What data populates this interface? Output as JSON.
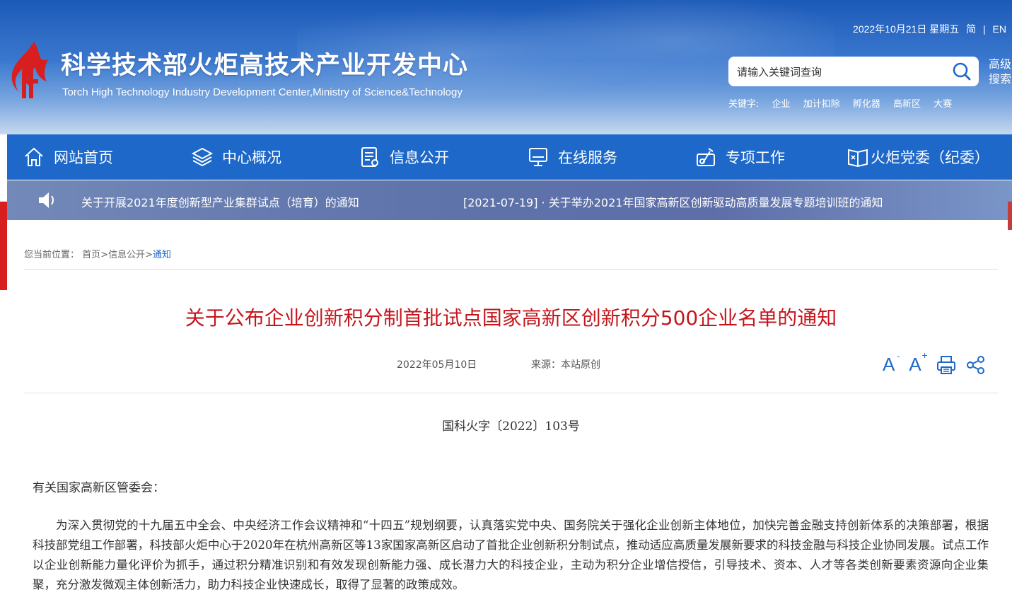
{
  "header": {
    "site_title_cn": "科学技术部火炬高技术产业开发中心",
    "site_title_en": "Torch High Technology Industry Development Center,Ministry of Science&Technology",
    "date": "2022年10月21日 星期五",
    "lang_simplified": "简",
    "separator": "|",
    "lang_english": "EN",
    "search_placeholder": "请输入关键词查询",
    "advanced_search": "高级搜索",
    "keywords_label": "关键字:",
    "keywords": [
      "企业",
      "加计扣除",
      "孵化器",
      "高新区",
      "大赛"
    ]
  },
  "nav": [
    {
      "label": "网站首页",
      "icon": "home-icon"
    },
    {
      "label": "中心概况",
      "icon": "layers-icon"
    },
    {
      "label": "信息公开",
      "icon": "document-icon"
    },
    {
      "label": "在线服务",
      "icon": "monitor-icon"
    },
    {
      "label": "专项工作",
      "icon": "tools-icon"
    },
    {
      "label": "火炬党委（纪委）",
      "icon": "party-book-icon"
    }
  ],
  "notice": {
    "items": [
      "关于开展2021年度创新型产业集群试点（培育）的通知",
      "[2021-07-19] · 关于举办2021年国家高新区创新驱动高质量发展专题培训班的通知"
    ]
  },
  "breadcrumb": {
    "label": "您当前位置：",
    "home": "首页",
    "sep1": ">",
    "section": "信息公开",
    "sep2": ">",
    "current": "通知"
  },
  "article": {
    "title": "关于公布企业创新积分制首批试点国家高新区创新积分500企业名单的通知",
    "date": "2022年05月10日",
    "source": "来源：本站原创",
    "font_smaller": "A",
    "font_larger": "A",
    "doc_number": "国科火字〔2022〕103号",
    "salutation": "有关国家高新区管委会：",
    "paragraph1": "为深入贯彻党的十九届五中全会、中央经济工作会议精神和“十四五”规划纲要，认真落实党中央、国务院关于强化企业创新主体地位，加快完善金融支持创新体系的决策部署，根据科技部党组工作部署，科技部火炬中心于2020年在杭州高新区等13家国家高新区启动了首批企业创新积分制试点，推动适应高质量发展新要求的科技金融与科技企业协同发展。试点工作以企业创新能力量化评价为抓手，通过积分精准识别和有效发现创新能力强、成长潜力大的科技企业，主动为积分企业增信授信，引导技术、资本、人才等各类创新要素资源向企业集聚，充分激发微观主体创新活力，助力科技企业快速成长，取得了显著的政策成效。"
  },
  "colors": {
    "nav_blue": "#1d68c9",
    "title_red": "#c5161d",
    "logo_red": "#d71f1f"
  }
}
